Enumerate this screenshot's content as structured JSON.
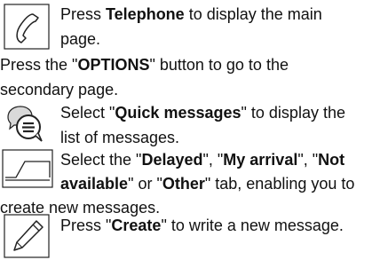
{
  "steps": [
    {
      "icon": "telephone-handset-icon",
      "line1": {
        "a": "Press ",
        "b": "Telephone",
        "c": " to display the main"
      },
      "line2": "page."
    },
    {
      "line1": {
        "a": "Press the \"",
        "b": "OPTIONS",
        "c": "\" button to go to the"
      },
      "line2": "secondary page."
    },
    {
      "icon": "quick-message-bubble-icon",
      "line1": {
        "a": "Select \"",
        "b": "Quick messages",
        "c": "\" to display the"
      },
      "line2": "list of messages."
    },
    {
      "icon": "tab-folder-icon",
      "line1": {
        "a": "Select the \"",
        "b1": "Delayed",
        "m1": "\", \"",
        "b2": "My arrival",
        "m2": "\", \"",
        "b3": "Not"
      },
      "line2": {
        "b": "available",
        "a": "\" or \"",
        "b2": "Other",
        "c": "\" tab, enabling you to"
      },
      "line3": "create new messages."
    },
    {
      "icon": "pen-write-icon",
      "line1": {
        "a": "Press \"",
        "b": "Create",
        "c": "\" to write a new message."
      }
    }
  ],
  "colors": {
    "text": "#111111",
    "icon": "#222222",
    "bubble_fill": "#d9d9d9"
  }
}
